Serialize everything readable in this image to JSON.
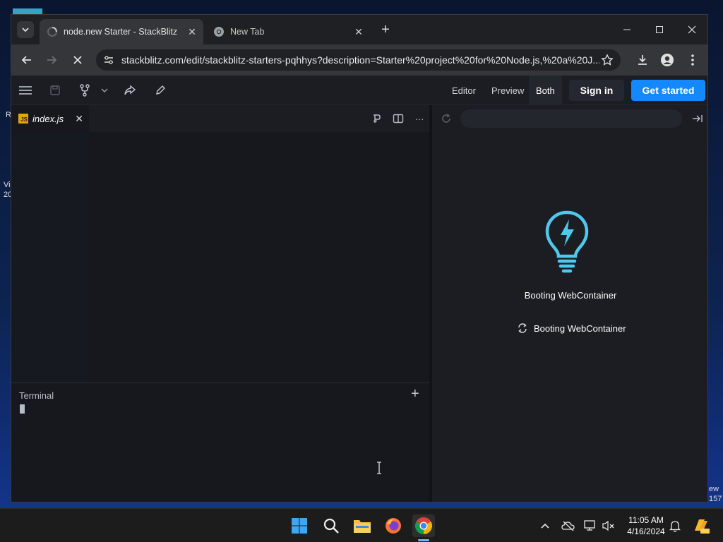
{
  "desktop": {
    "edge_left_1": "R",
    "edge_left_2": "Vi",
    "edge_left_3": "20",
    "edge_right_1": "ew",
    "edge_right_2": "157"
  },
  "browser": {
    "tabs": [
      {
        "title": "node.new Starter - StackBlitz",
        "active": true
      },
      {
        "title": "New Tab",
        "active": false
      }
    ],
    "url": "stackblitz.com/edit/stackblitz-starters-pqhhys?description=Starter%20project%20for%20Node.js,%20a%20J..."
  },
  "stackblitz": {
    "view_modes": [
      "Editor",
      "Preview",
      "Both"
    ],
    "active_view": "Both",
    "sign_in_label": "Sign in",
    "get_started_label": "Get started",
    "open_file": {
      "name": "index.js",
      "badge": "JS"
    },
    "terminal_label": "Terminal",
    "boot_title": "Booting WebContainer",
    "boot_status": "Booting WebContainer",
    "accent_color": "#1389fd",
    "bulb_color": "#4fc8ec"
  },
  "taskbar": {
    "apps": [
      "start-icon",
      "search-icon",
      "file-explorer-icon",
      "firefox-icon",
      "chrome-icon"
    ],
    "active_app": "chrome-icon",
    "time": "11:05 AM",
    "date": "4/16/2024"
  }
}
